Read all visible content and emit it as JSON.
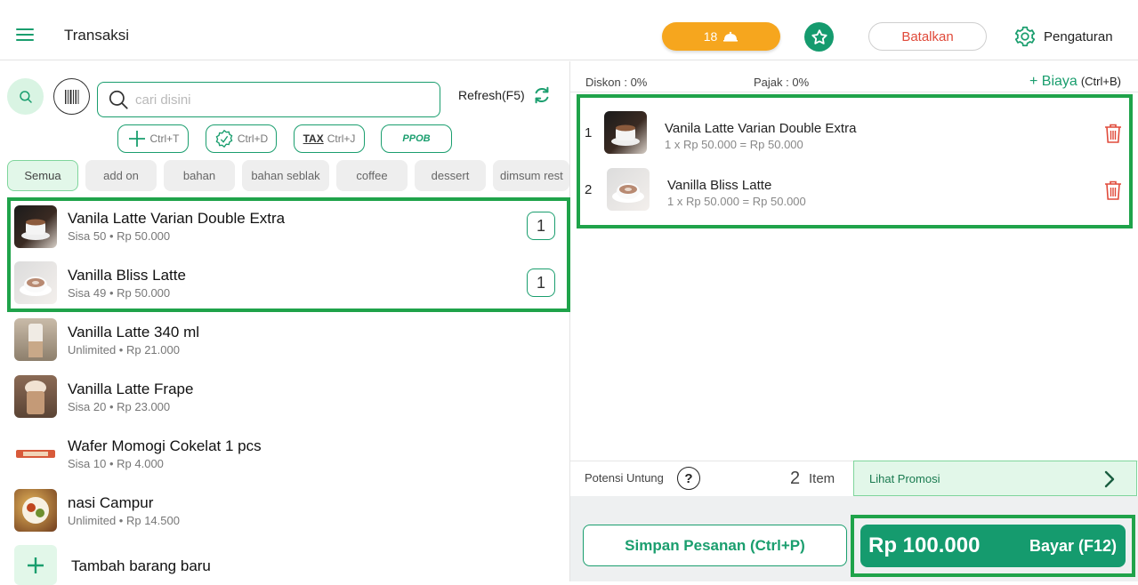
{
  "header": {
    "title": "Transaksi",
    "queue_count": "18",
    "cancel_label": "Batalkan",
    "settings_label": "Pengaturan"
  },
  "search": {
    "placeholder": "cari disini",
    "refresh_label": "Refresh(F5)"
  },
  "shortcuts": [
    {
      "label": "Ctrl+T",
      "icon": "plus-icon"
    },
    {
      "label": "Ctrl+D",
      "icon": "discount-badge-icon"
    },
    {
      "label": "Ctrl+J",
      "icon": "tax-icon",
      "prefix": "TAX"
    },
    {
      "label": "PPOB",
      "icon": "ppob-icon"
    }
  ],
  "categories": [
    "Semua",
    "add on",
    "bahan",
    "bahan seblak",
    "coffee",
    "dessert",
    "dimsum rest"
  ],
  "products": [
    {
      "name": "Vanila Latte Varian Double Extra",
      "sub": "Sisa 50 • Rp 50.000",
      "qty": "1"
    },
    {
      "name": "Vanilla Bliss Latte",
      "sub": "Sisa 49 • Rp 50.000",
      "qty": "1"
    },
    {
      "name": "Vanilla Latte 340 ml",
      "sub": "Unlimited • Rp 21.000"
    },
    {
      "name": "Vanilla Latte Frape",
      "sub": "Sisa 20 • Rp 23.000"
    },
    {
      "name": "Wafer Momogi Cokelat  1 pcs",
      "sub": "Sisa 10 • Rp 4.000"
    },
    {
      "name": "nasi Campur",
      "sub": "Unlimited • Rp 14.500"
    }
  ],
  "add_new_label": "Tambah barang baru",
  "cart": {
    "diskon": "Diskon : 0%",
    "pajak": "Pajak : 0%",
    "biaya": "+ Biaya",
    "biaya_shortcut": "(Ctrl+B)",
    "items": [
      {
        "num": "1",
        "name": "Vanila Latte Varian Double Extra",
        "sub": "1 x Rp 50.000 = Rp 50.000"
      },
      {
        "num": "2",
        "name": "Vanilla Bliss Latte",
        "sub": "1 x Rp 50.000 = Rp 50.000"
      }
    ],
    "potensi_label": "Potensi Untung",
    "help_symbol": "?",
    "item_count": "2",
    "item_label": "Item",
    "promo_label": "Lihat Promosi",
    "save_label": "Simpan Pesanan (Ctrl+P)",
    "total": "Rp 100.000",
    "pay_label": "Bayar (F12)"
  },
  "colors": {
    "primary": "#159b6e",
    "queue": "#f6a61e",
    "danger": "#e04a3a",
    "highlight": "#1fa34a"
  }
}
